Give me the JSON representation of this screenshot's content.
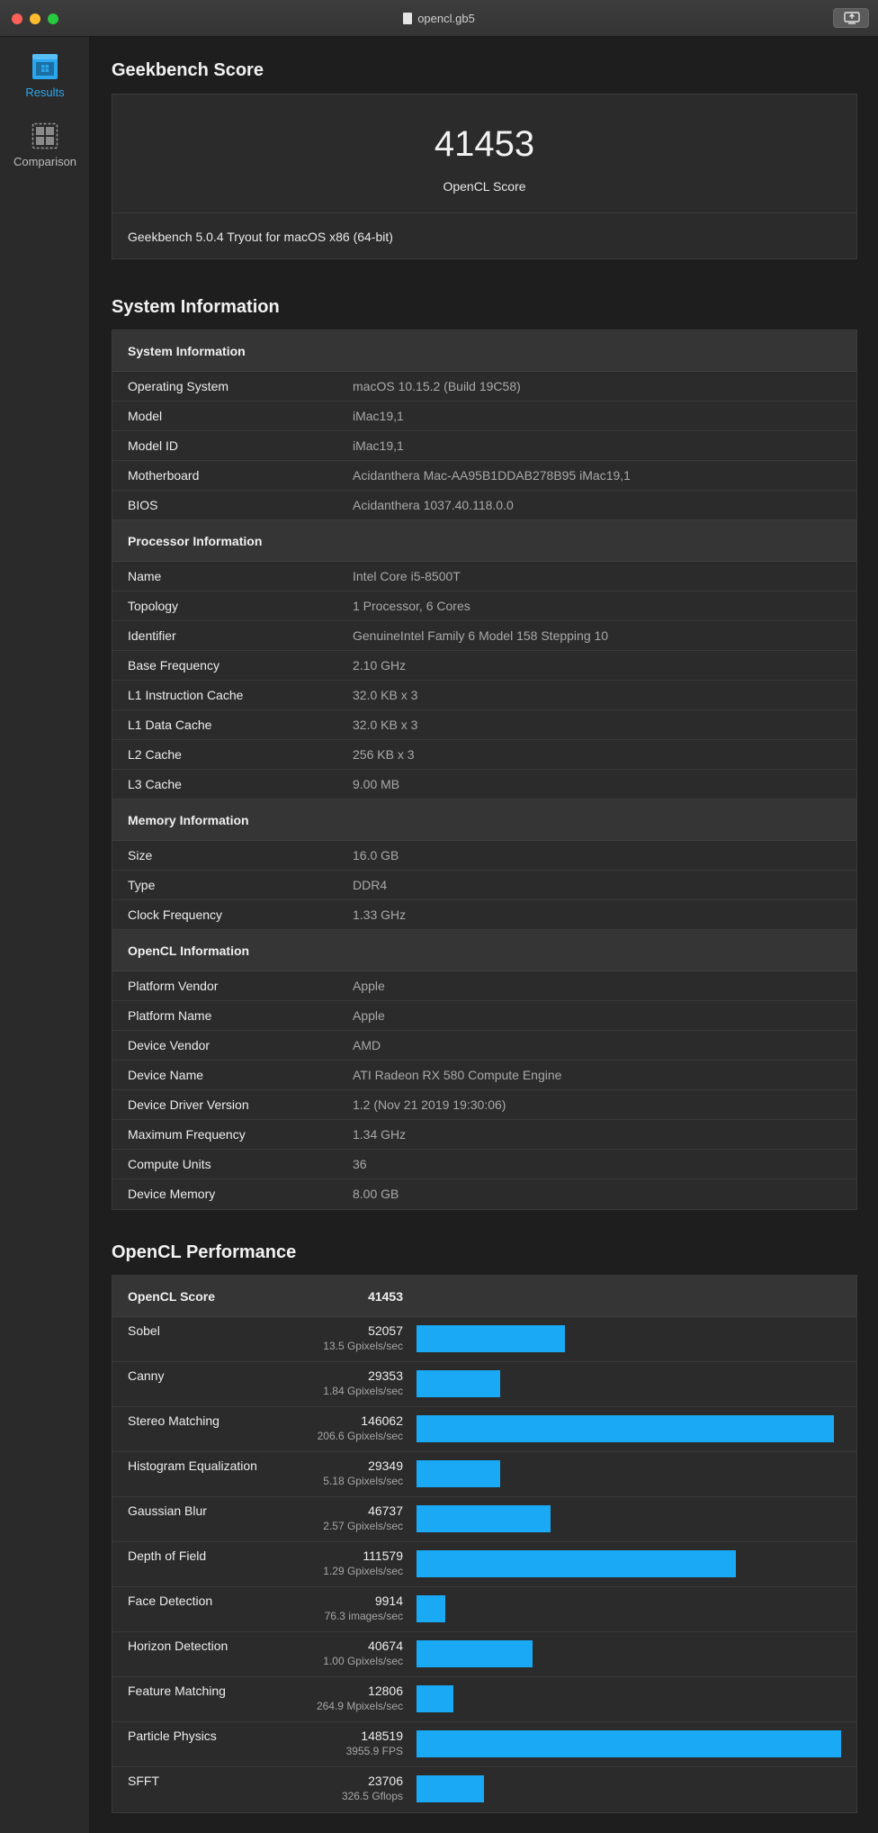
{
  "window": {
    "title": "opencl.gb5"
  },
  "sidebar": {
    "items": [
      {
        "label": "Results",
        "icon": "results-icon",
        "active": true
      },
      {
        "label": "Comparison",
        "icon": "comparison-icon",
        "active": false
      }
    ]
  },
  "score": {
    "heading": "Geekbench Score",
    "value": "41453",
    "label": "OpenCL Score",
    "version": "Geekbench 5.0.4 Tryout for macOS x86 (64-bit)"
  },
  "system": {
    "heading": "System Information",
    "groups": [
      {
        "title": "System Information",
        "rows": [
          {
            "k": "Operating System",
            "v": "macOS 10.15.2 (Build 19C58)"
          },
          {
            "k": "Model",
            "v": "iMac19,1"
          },
          {
            "k": "Model ID",
            "v": "iMac19,1"
          },
          {
            "k": "Motherboard",
            "v": "Acidanthera Mac-AA95B1DDAB278B95 iMac19,1"
          },
          {
            "k": "BIOS",
            "v": "Acidanthera 1037.40.118.0.0"
          }
        ]
      },
      {
        "title": "Processor Information",
        "rows": [
          {
            "k": "Name",
            "v": "Intel Core i5-8500T"
          },
          {
            "k": "Topology",
            "v": "1 Processor, 6 Cores"
          },
          {
            "k": "Identifier",
            "v": "GenuineIntel Family 6 Model 158 Stepping 10"
          },
          {
            "k": "Base Frequency",
            "v": "2.10 GHz"
          },
          {
            "k": "L1 Instruction Cache",
            "v": "32.0 KB x 3"
          },
          {
            "k": "L1 Data Cache",
            "v": "32.0 KB x 3"
          },
          {
            "k": "L2 Cache",
            "v": "256 KB x 3"
          },
          {
            "k": "L3 Cache",
            "v": "9.00 MB"
          }
        ]
      },
      {
        "title": "Memory Information",
        "rows": [
          {
            "k": "Size",
            "v": "16.0 GB"
          },
          {
            "k": "Type",
            "v": "DDR4"
          },
          {
            "k": "Clock Frequency",
            "v": "1.33 GHz"
          }
        ]
      },
      {
        "title": "OpenCL Information",
        "rows": [
          {
            "k": "Platform Vendor",
            "v": "Apple"
          },
          {
            "k": "Platform Name",
            "v": "Apple"
          },
          {
            "k": "Device Vendor",
            "v": "AMD"
          },
          {
            "k": "Device Name",
            "v": "ATI Radeon RX 580 Compute Engine"
          },
          {
            "k": "Device Driver Version",
            "v": "1.2 (Nov 21 2019 19:30:06)"
          },
          {
            "k": "Maximum Frequency",
            "v": "1.34 GHz"
          },
          {
            "k": "Compute Units",
            "v": "36"
          },
          {
            "k": "Device Memory",
            "v": "8.00 GB"
          }
        ]
      }
    ]
  },
  "performance": {
    "heading": "OpenCL Performance",
    "header_label": "OpenCL Score",
    "header_value": "41453",
    "bar_max": 148519,
    "bar_color": "#1aa9f4",
    "rows": [
      {
        "name": "Sobel",
        "score": 52057,
        "rate": "13.5 Gpixels/sec"
      },
      {
        "name": "Canny",
        "score": 29353,
        "rate": "1.84 Gpixels/sec"
      },
      {
        "name": "Stereo Matching",
        "score": 146062,
        "rate": "206.6 Gpixels/sec"
      },
      {
        "name": "Histogram Equalization",
        "score": 29349,
        "rate": "5.18 Gpixels/sec"
      },
      {
        "name": "Gaussian Blur",
        "score": 46737,
        "rate": "2.57 Gpixels/sec"
      },
      {
        "name": "Depth of Field",
        "score": 111579,
        "rate": "1.29 Gpixels/sec"
      },
      {
        "name": "Face Detection",
        "score": 9914,
        "rate": "76.3 images/sec"
      },
      {
        "name": "Horizon Detection",
        "score": 40674,
        "rate": "1.00 Gpixels/sec"
      },
      {
        "name": "Feature Matching",
        "score": 12806,
        "rate": "264.9 Mpixels/sec"
      },
      {
        "name": "Particle Physics",
        "score": 148519,
        "rate": "3955.9 FPS"
      },
      {
        "name": "SFFT",
        "score": 23706,
        "rate": "326.5 Gflops"
      }
    ]
  }
}
